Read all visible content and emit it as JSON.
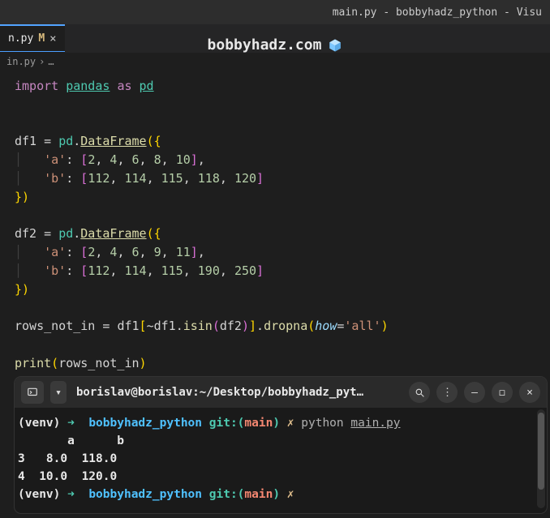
{
  "window": {
    "title": "main.py - bobbyhadz_python - Visu"
  },
  "tab": {
    "filename": "n.py",
    "modified_indicator": "M",
    "close_glyph": "×"
  },
  "overlay": {
    "site": "bobbyhadz.com"
  },
  "breadcrumb": {
    "file": "in.py",
    "sep": "›",
    "more": "…"
  },
  "code": {
    "import_kw": "import",
    "module": "pandas",
    "as_kw": "as",
    "alias": "pd",
    "df1": "df1",
    "df2": "df2",
    "eq": "=",
    "dot": ".",
    "DataFrame": "DataFrame",
    "key_a": "'a'",
    "key_b": "'b'",
    "colon": ":",
    "list1_a": [
      "2",
      "4",
      "6",
      "8",
      "10"
    ],
    "list1_b": [
      "112",
      "114",
      "115",
      "118",
      "120"
    ],
    "list2_a": [
      "2",
      "4",
      "6",
      "9",
      "11"
    ],
    "list2_b": [
      "112",
      "114",
      "115",
      "190",
      "250"
    ],
    "rows_var": "rows_not_in",
    "tilde": "~",
    "isin": "isin",
    "dropna": "dropna",
    "how_param": "how",
    "how_val": "'all'",
    "print_fn": "print"
  },
  "terminal": {
    "header_title": "borislav@borislav:~/Desktop/bobbyhadz_pyt…",
    "venv": "(venv)",
    "arrow": "➜",
    "dir": "bobbyhadz_python",
    "git_label": "git:",
    "branch": "main",
    "x_mark": "✗",
    "cmd": "python",
    "cmd_file": "main.py",
    "out_header": "       a      b",
    "out_row1": "3   8.0  118.0",
    "out_row2": "4  10.0  120.0"
  }
}
